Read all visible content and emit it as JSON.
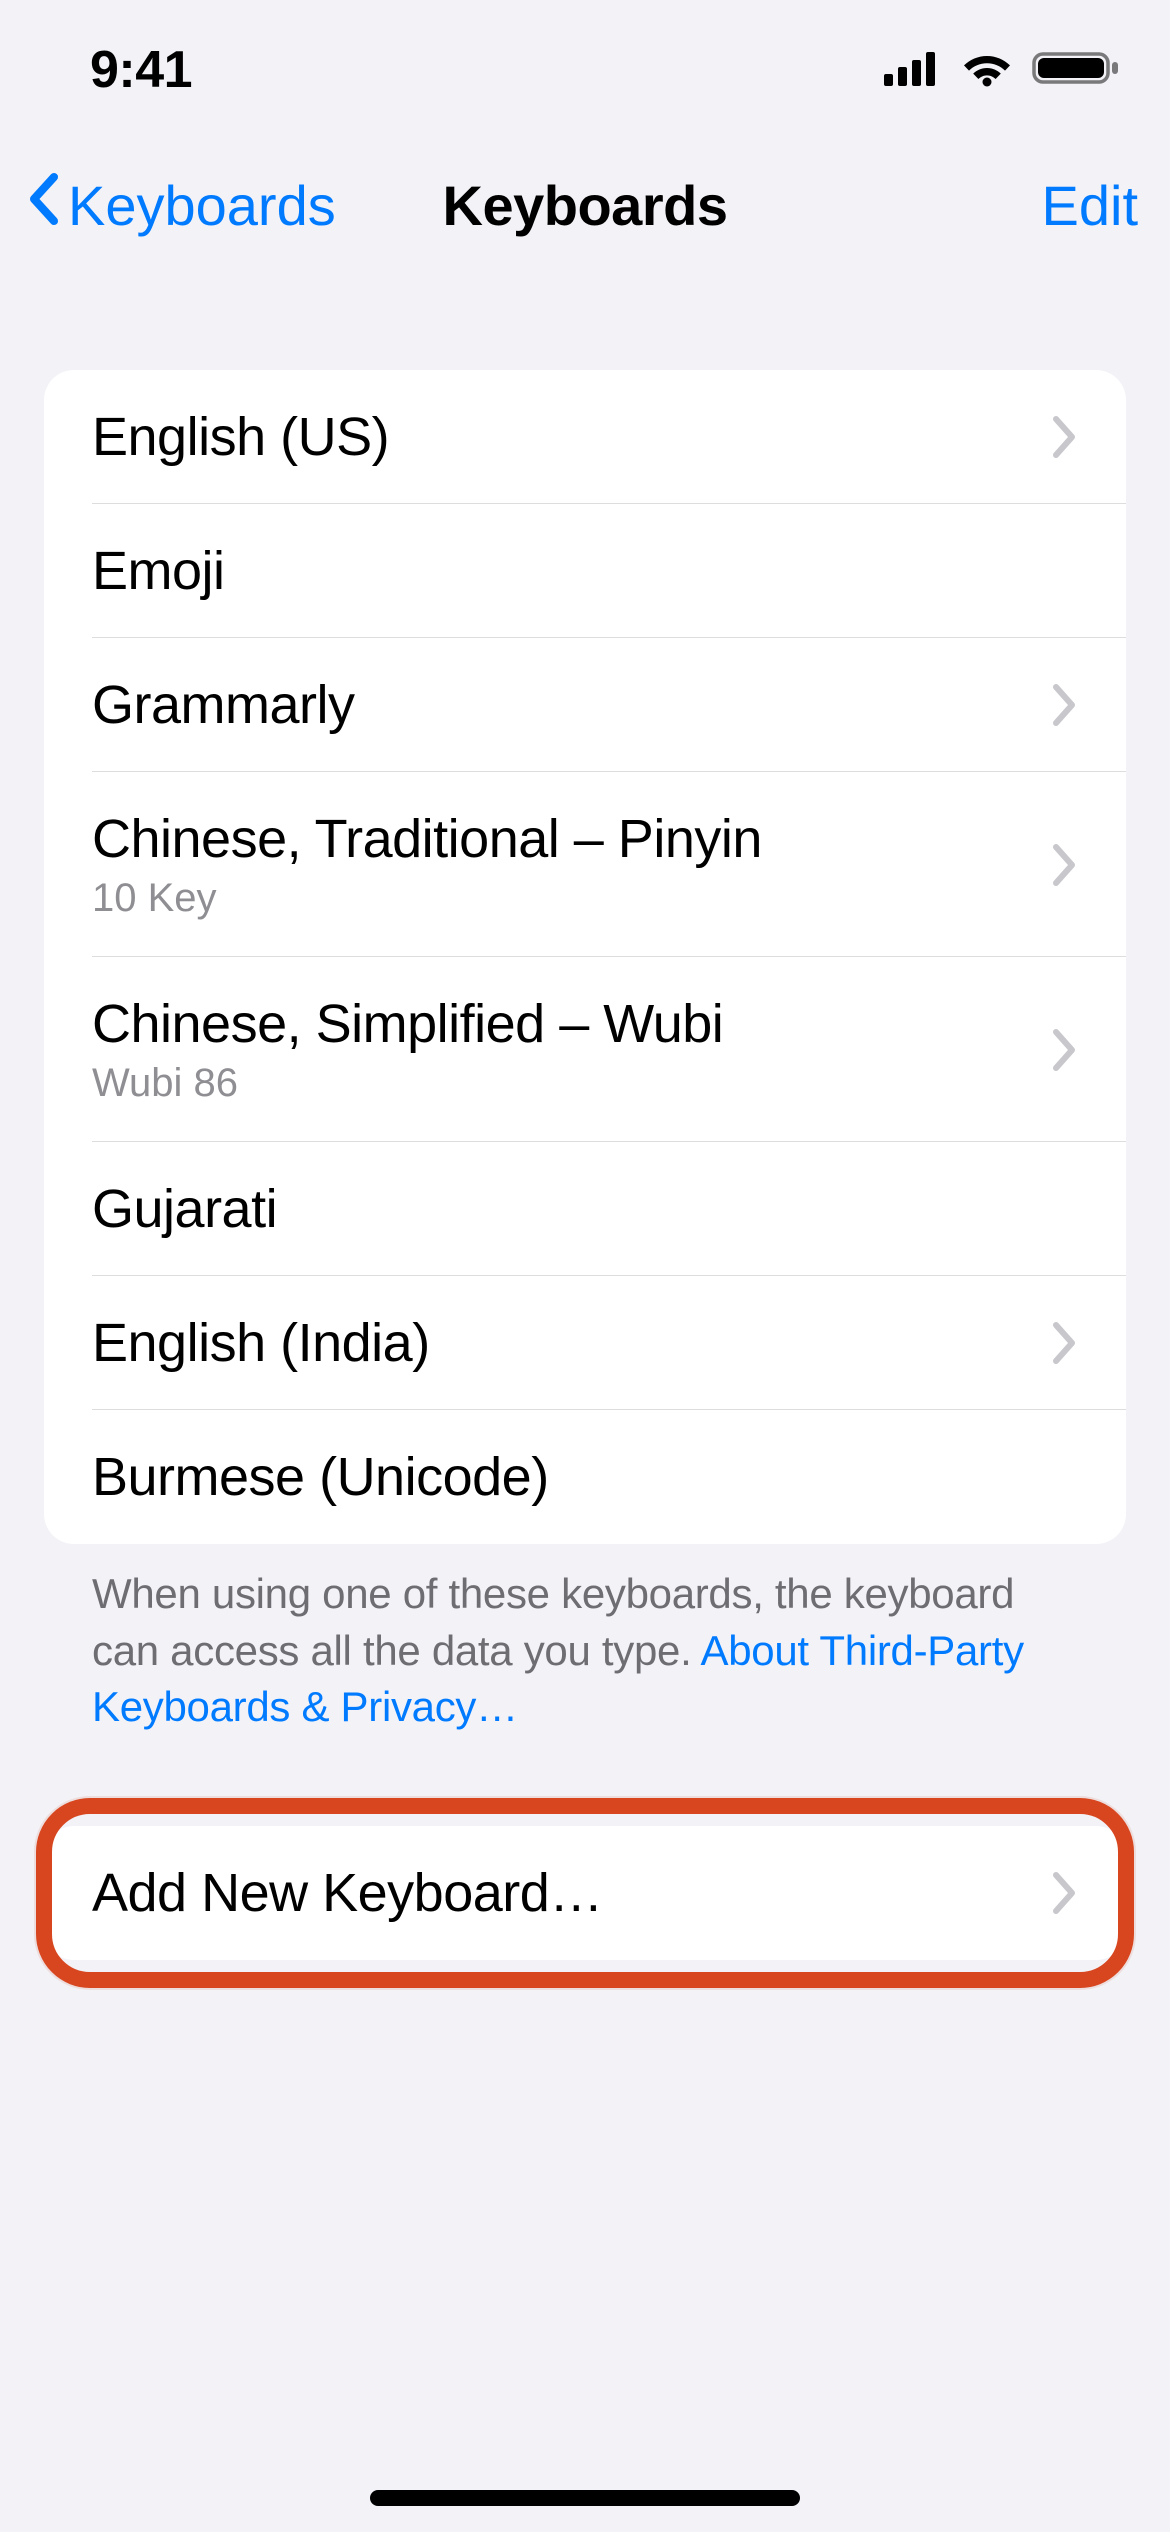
{
  "statusBar": {
    "time": "9:41"
  },
  "nav": {
    "backLabel": "Keyboards",
    "title": "Keyboards",
    "edit": "Edit"
  },
  "keyboards": [
    {
      "label": "English (US)",
      "sub": null,
      "chevron": true
    },
    {
      "label": "Emoji",
      "sub": null,
      "chevron": false
    },
    {
      "label": "Grammarly",
      "sub": null,
      "chevron": true
    },
    {
      "label": "Chinese, Traditional – Pinyin",
      "sub": "10 Key",
      "chevron": true
    },
    {
      "label": "Chinese, Simplified – Wubi",
      "sub": "Wubi 86",
      "chevron": true
    },
    {
      "label": "Gujarati",
      "sub": null,
      "chevron": false
    },
    {
      "label": "English (India)",
      "sub": null,
      "chevron": true
    },
    {
      "label": "Burmese (Unicode)",
      "sub": null,
      "chevron": false
    }
  ],
  "footer": {
    "text": "When using one of these keyboards, the keyboard can access all the data you type. ",
    "link": "About Third-Party Keyboards & Privacy…"
  },
  "addRow": {
    "label": "Add New Keyboard…"
  },
  "colors": {
    "accent": "#007aff",
    "highlight": "#d7461f"
  }
}
